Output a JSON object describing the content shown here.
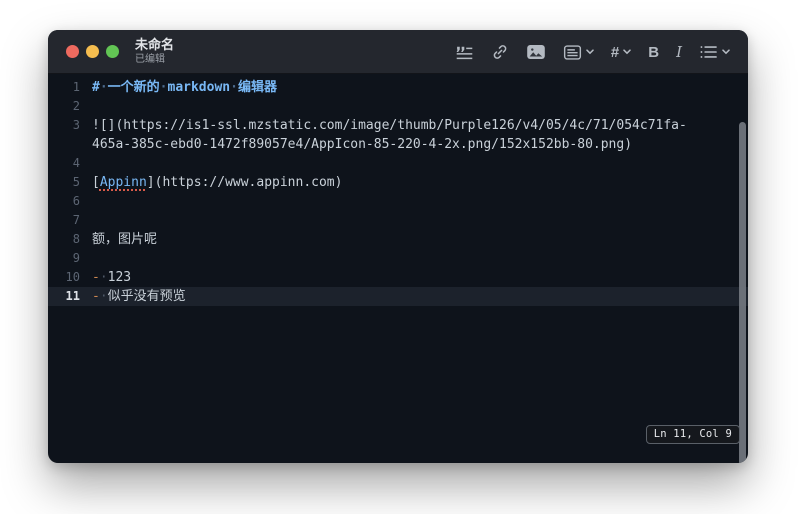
{
  "window": {
    "title": "未命名",
    "subtitle": "已编辑"
  },
  "toolbar": {
    "heading_label": "#",
    "bold_label": "B",
    "italic_label": "I",
    "items": [
      {
        "icon": "blockquote-icon",
        "dropdown": false
      },
      {
        "icon": "link-icon",
        "dropdown": false
      },
      {
        "icon": "image-icon",
        "dropdown": false
      },
      {
        "icon": "panel-icon",
        "dropdown": true
      },
      {
        "icon": "heading-icon",
        "dropdown": true
      },
      {
        "icon": "bold-icon",
        "dropdown": false
      },
      {
        "icon": "italic-icon",
        "dropdown": false
      },
      {
        "icon": "list-icon",
        "dropdown": true
      }
    ]
  },
  "editor": {
    "whitespace_dot": "·",
    "rows": [
      {
        "num": "1",
        "current": false,
        "segments": [
          {
            "t": "#",
            "c": "heading"
          },
          {
            "t": "·",
            "c": "hdot"
          },
          {
            "t": "一个新的",
            "c": "heading"
          },
          {
            "t": "·",
            "c": "hdot"
          },
          {
            "t": "markdown",
            "c": "heading"
          },
          {
            "t": "·",
            "c": "hdot"
          },
          {
            "t": "编辑器",
            "c": "heading"
          }
        ]
      },
      {
        "num": "2",
        "current": false,
        "segments": []
      },
      {
        "num": "3",
        "current": false,
        "segments": [
          {
            "t": "![](https://is1-ssl.mzstatic.com/image/thumb/Purple126/v4/05/4c/71/054c71fa-",
            "c": "default"
          }
        ]
      },
      {
        "num": "",
        "current": false,
        "segments": [
          {
            "t": "465a-385c-ebd0-1472f89057e4/AppIcon-85-220-4-2x.png/152x152bb-80.png)",
            "c": "default"
          }
        ]
      },
      {
        "num": "4",
        "current": false,
        "segments": []
      },
      {
        "num": "5",
        "current": false,
        "segments": [
          {
            "t": "[",
            "c": "default"
          },
          {
            "t": "Appinn",
            "c": "link"
          },
          {
            "t": "](https://www.appinn.com)",
            "c": "default"
          }
        ]
      },
      {
        "num": "6",
        "current": false,
        "segments": []
      },
      {
        "num": "7",
        "current": false,
        "segments": []
      },
      {
        "num": "8",
        "current": false,
        "segments": [
          {
            "t": "额，图片呢",
            "c": "default"
          }
        ]
      },
      {
        "num": "9",
        "current": false,
        "segments": []
      },
      {
        "num": "10",
        "current": false,
        "segments": [
          {
            "t": "-",
            "c": "orange"
          },
          {
            "t": "·",
            "c": "dot"
          },
          {
            "t": "123",
            "c": "default"
          }
        ]
      },
      {
        "num": "11",
        "current": true,
        "segments": [
          {
            "t": "-",
            "c": "orange"
          },
          {
            "t": "·",
            "c": "dot"
          },
          {
            "t": "似乎没有预览",
            "c": "default"
          }
        ]
      }
    ]
  },
  "status": {
    "position": "Ln 11, Col 9"
  },
  "colors": {
    "editor_bg": "#0e131b",
    "titlebar_bg": "#24272e",
    "text_default": "#c9d1d9",
    "heading_blue": "#79b8f5",
    "link_blue": "#79b8f5",
    "list_dash_orange": "#cd8852",
    "line_number": "#5c6573",
    "current_line_bg": "#1c222c",
    "traffic_red": "#ee6a5f",
    "traffic_yellow": "#f5bd4f",
    "traffic_green": "#62c554"
  }
}
